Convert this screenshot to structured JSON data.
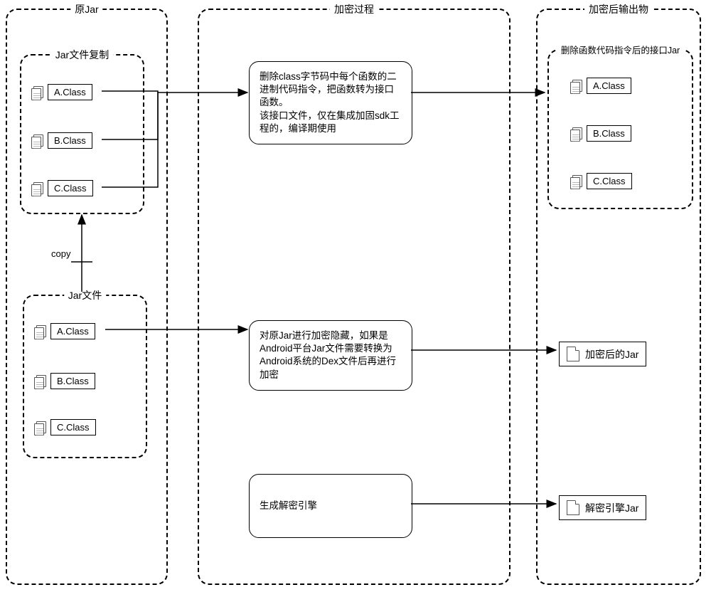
{
  "column_left": {
    "title": "原Jar",
    "copy_panel_title": "Jar文件复制",
    "jar_panel_title": "Jar文件",
    "classes": [
      "A.Class",
      "B.Class",
      "C.Class"
    ],
    "copy_label": "copy"
  },
  "column_mid": {
    "title": "加密过程",
    "process1": "删除class字节码中每个函数的二进制代码指令，把函数转为接口函数。\n该接口文件，仅在集成加固sdk工程的，编译期使用",
    "process2": "对原Jar进行加密隐藏，如果是Android平台Jar文件需要转换为Android系统的Dex文件后再进行加密",
    "process3": "生成解密引擎"
  },
  "column_right": {
    "title": "加密后输出物",
    "output_panel_title": "删除函数代码指令后的接口Jar",
    "classes": [
      "A.Class",
      "B.Class",
      "C.Class"
    ],
    "output2": "加密后的Jar",
    "output3": "解密引擎Jar"
  }
}
